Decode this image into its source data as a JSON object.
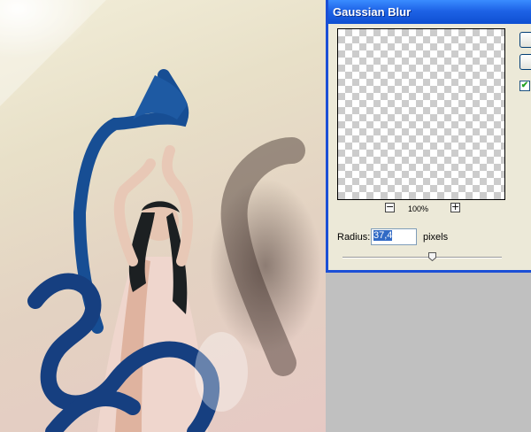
{
  "dialog": {
    "title": "Gaussian Blur",
    "zoom": {
      "out_symbol": "−",
      "level": "100%",
      "in_symbol": "+"
    },
    "radius": {
      "label": "Radius:",
      "value": "37,4",
      "units": "pixels",
      "slider_position_fraction": 0.56
    },
    "preview_checkbox": {
      "checked": true,
      "check_symbol": "✔"
    }
  },
  "photo": {
    "description_icon": "photo-canvas"
  },
  "colors": {
    "titlebar": "#0e4fd2",
    "dialog_bg": "#ece9d8",
    "selection": "#316ac5",
    "ribbon": "#1a4f93"
  }
}
